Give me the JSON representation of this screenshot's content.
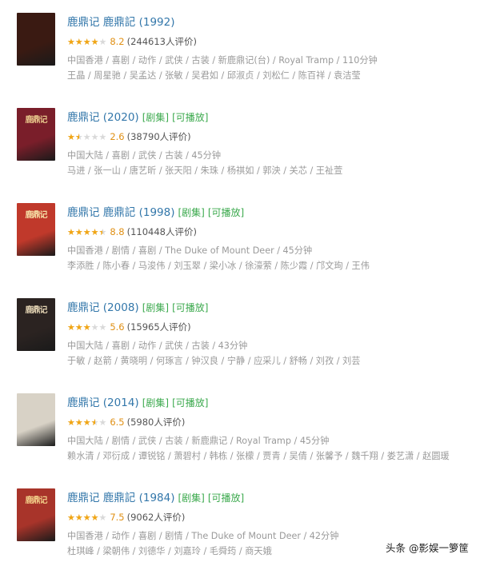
{
  "items": [
    {
      "title": "鹿鼎记 鹿鼎記 (1992)",
      "tags": [],
      "rating": 0.8,
      "score": "8.2",
      "votes": "(244613人评价)",
      "info": "中国香港 / 喜剧 / 动作 / 武侠 / 古装 / 新鹿鼎记(台) / Royal Tramp / 110分钟",
      "cast": "王晶 / 周星驰 / 吴孟达 / 张敏 / 吴君如 / 邱淑贞 / 刘松仁 / 陈百祥 / 袁洁莹",
      "poster": {
        "bg": "#3a1a12",
        "fg": "#c99a4a",
        "label": ""
      }
    },
    {
      "title": "鹿鼎记 (2020)",
      "tags": [
        "[剧集]",
        "[可播放]"
      ],
      "rating": 0.3,
      "score": "2.6",
      "votes": "(38790人评价)",
      "info": "中国大陆 / 喜剧 / 武侠 / 古装 / 45分钟",
      "cast": "马进 / 张一山 / 唐艺昕 / 张天阳 / 朱珠 / 杨祺如 / 郭泱 / 关芯 / 王祉萱",
      "poster": {
        "bg": "#7a1e2a",
        "fg": "#e9c98c",
        "label": "鹿鼎记"
      }
    },
    {
      "title": "鹿鼎记 鹿鼎記 (1998)",
      "tags": [
        "[剧集]",
        "[可播放]"
      ],
      "rating": 0.9,
      "score": "8.8",
      "votes": "(110448人评价)",
      "info": "中国香港 / 剧情 / 喜剧 / The Duke of Mount Deer / 45分钟",
      "cast": "李添胜 / 陈小春 / 马浚伟 / 刘玉翠 / 梁小冰 / 徐濠萦 / 陈少霞 / 邝文珣 / 王伟",
      "poster": {
        "bg": "#c0392b",
        "fg": "#f6e2a8",
        "label": "鹿鼎记"
      }
    },
    {
      "title": "鹿鼎记 (2008)",
      "tags": [
        "[剧集]",
        "[可播放]"
      ],
      "rating": 0.6,
      "score": "5.6",
      "votes": "(15965人评价)",
      "info": "中国大陆 / 喜剧 / 动作 / 武侠 / 古装 / 43分钟",
      "cast": "于敏 / 赵箭 / 黄晓明 / 何琢言 / 钟汉良 / 宁静 / 应采儿 / 舒畅 / 刘孜 / 刘芸",
      "poster": {
        "bg": "#2b2321",
        "fg": "#e7d7b6",
        "label": "鹿鼎记"
      }
    },
    {
      "title": "鹿鼎记 (2014)",
      "tags": [
        "[剧集]",
        "[可播放]"
      ],
      "rating": 0.7,
      "score": "6.5",
      "votes": "(5980人评价)",
      "info": "中国大陆 / 剧情 / 武侠 / 古装 / 新鹿鼎记 / Royal Tramp / 45分钟",
      "cast": "赖水清 / 邓衍成 / 谭锐铭 / 萧碧村 / 韩栋 / 张檬 / 贾青 / 吴倩 / 张馨予 / 魏千翔 / 娄艺潇 / 赵圆瑗",
      "poster": {
        "bg": "#d8d2c6",
        "fg": "#2f5d8a",
        "label": ""
      }
    },
    {
      "title": "鹿鼎记 鹿鼎記 (1984)",
      "tags": [
        "[剧集]",
        "[可播放]"
      ],
      "rating": 0.8,
      "score": "7.5",
      "votes": "(9062人评价)",
      "info": "中国香港 / 动作 / 喜剧 / 剧情 / The Duke of Mount Deer / 42分钟",
      "cast": "杜琪峰 / 梁朝伟 / 刘德华 / 刘嘉玲 / 毛舜筠 / 商天娥",
      "poster": {
        "bg": "#a8342a",
        "fg": "#f3d18a",
        "label": "鹿鼎记"
      }
    }
  ],
  "watermark": "头条 @影娱一箩筐"
}
